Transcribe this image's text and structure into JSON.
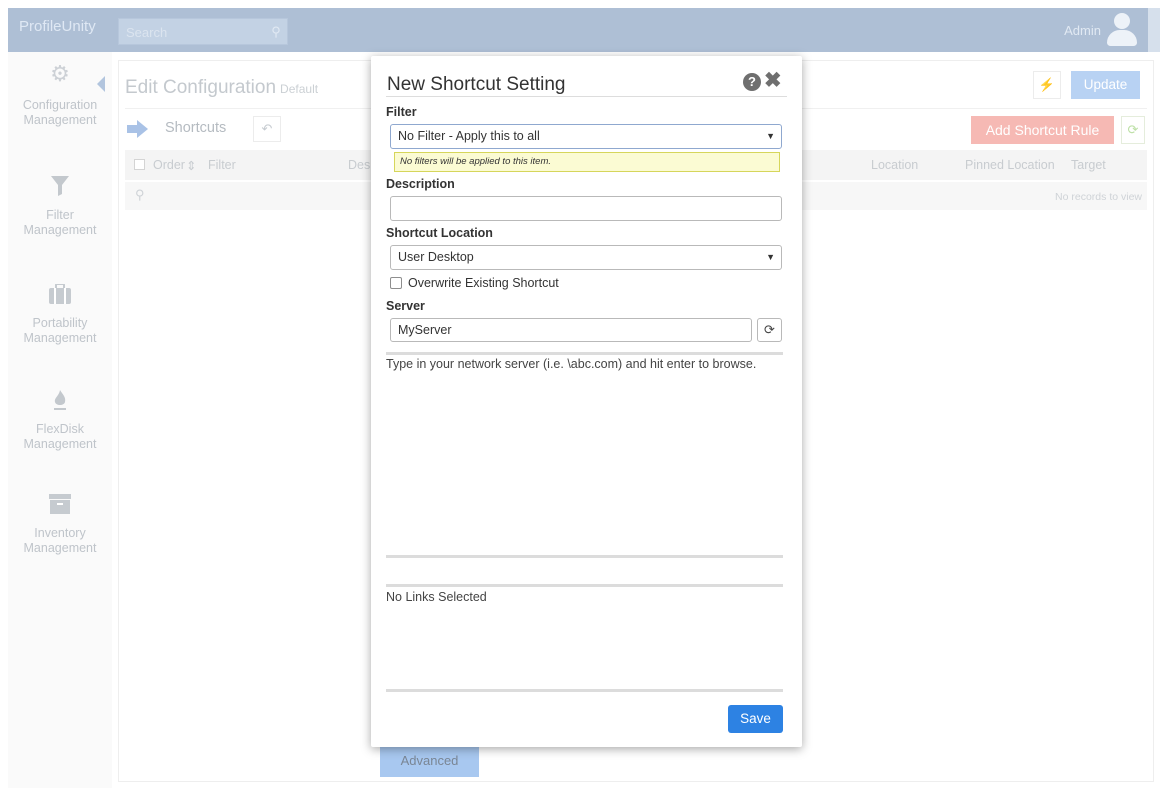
{
  "topbar": {
    "brand": "ProfileUnity",
    "search_placeholder": "Search",
    "user": "Admin"
  },
  "sidebar": {
    "items": [
      {
        "label": "Configuration Management",
        "icon": "gears-icon"
      },
      {
        "label": "Filter Management",
        "icon": "funnel-icon"
      },
      {
        "label": "Portability Management",
        "icon": "briefcase-icon"
      },
      {
        "label": "FlexDisk Management",
        "icon": "flame-icon"
      },
      {
        "label": "Inventory Management",
        "icon": "archive-icon"
      }
    ]
  },
  "main": {
    "title": "Edit Configuration",
    "subtitle": "Default",
    "update_label": "Update",
    "section_label": "Shortcuts",
    "add_rule_label": "Add Shortcut Rule",
    "columns": [
      "Order",
      "Filter",
      "Des",
      "Location",
      "Pinned Location",
      "Target"
    ],
    "empty_text": "No records to view",
    "advanced_label": "Advanced"
  },
  "modal": {
    "title": "New Shortcut Setting",
    "filter_label": "Filter",
    "filter_value": "No Filter - Apply this to all",
    "filter_tip": "No filters will be applied to this item.",
    "description_label": "Description",
    "description_value": "",
    "location_label": "Shortcut Location",
    "location_value": "User Desktop",
    "overwrite_label": "Overwrite Existing Shortcut",
    "overwrite_checked": false,
    "server_label": "Server",
    "server_value": "MyServer",
    "browse_hint": "Type in your network server (i.e. \\abc.com) and hit enter to browse.",
    "links_text": "No Links Selected",
    "save_label": "Save"
  }
}
